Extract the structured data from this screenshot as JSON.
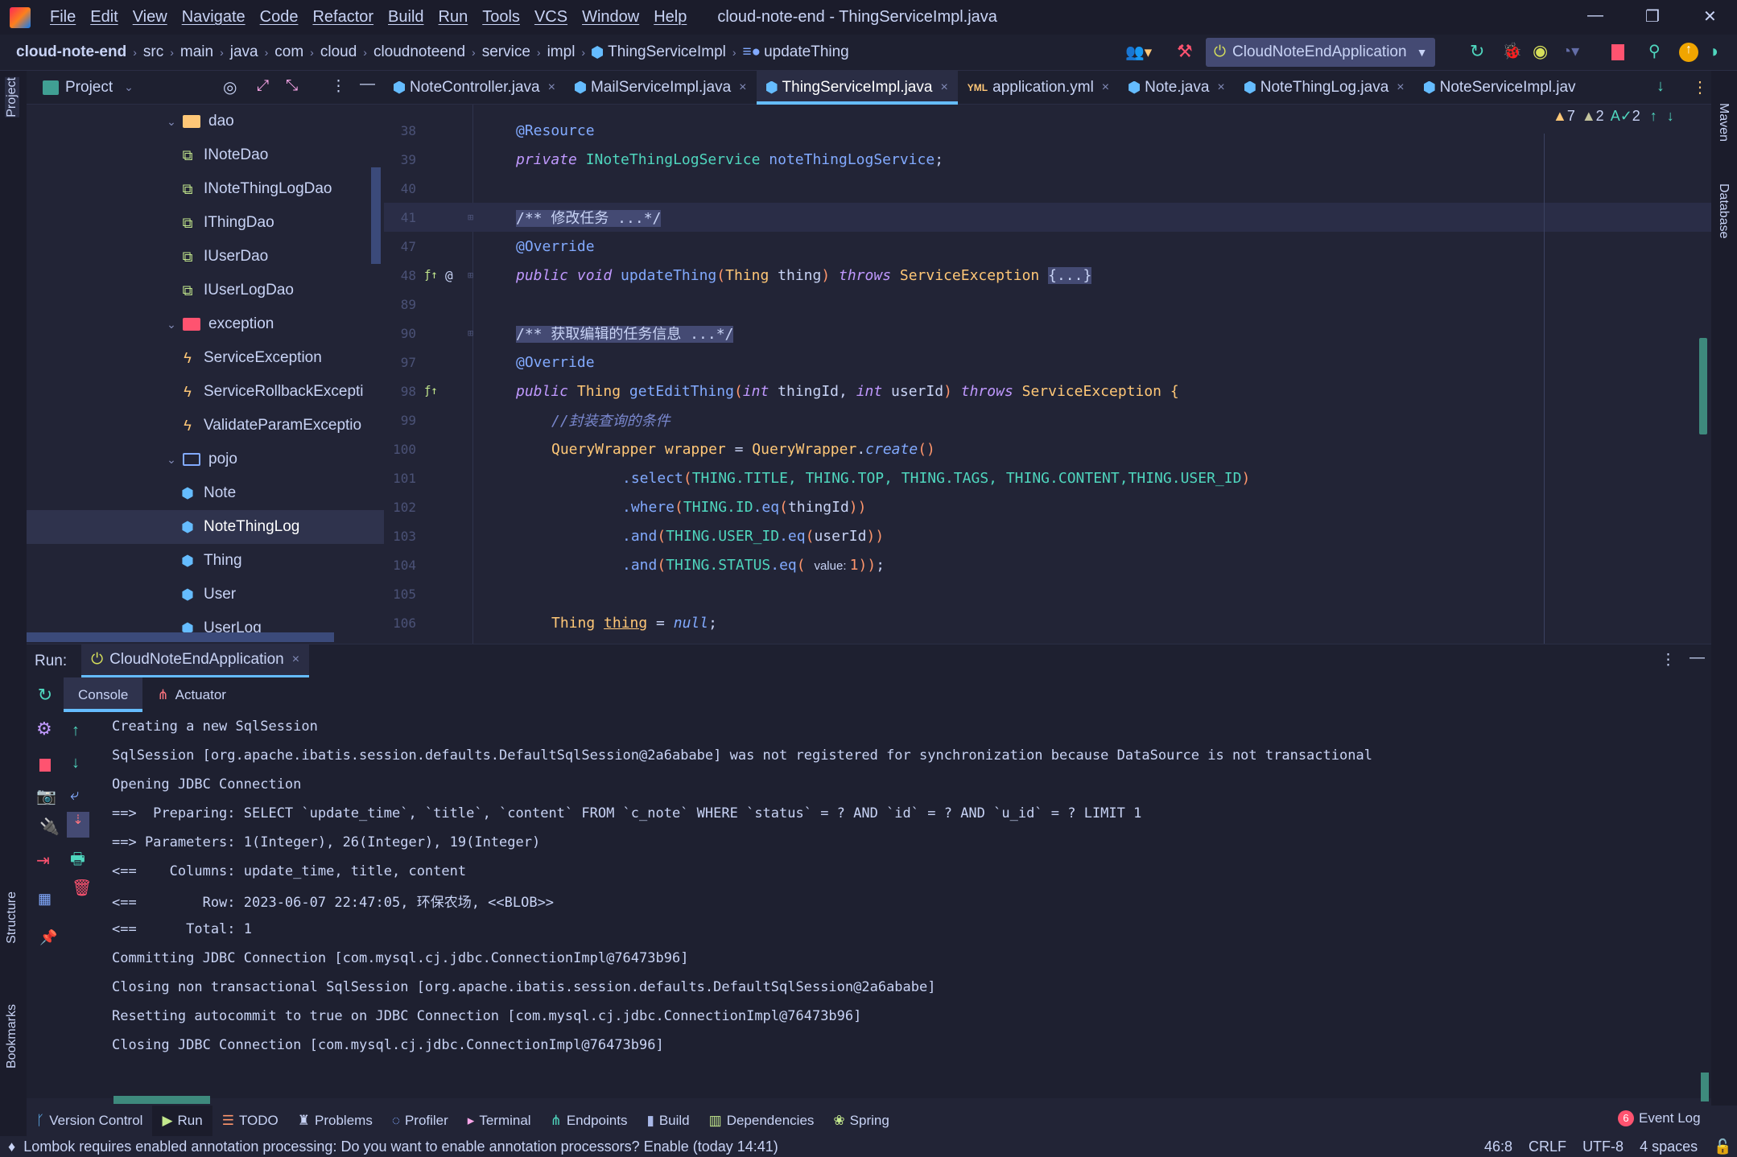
{
  "colors": {
    "accent": "#65bcff",
    "keyword": "#c099ff",
    "type": "#ffc777",
    "function": "#82aaff",
    "constant": "#4fd6be",
    "comment": "#7a88cf",
    "stop": "#ff5370",
    "run": "#c3e88d"
  },
  "titlebar": {
    "menu": [
      "File",
      "Edit",
      "View",
      "Navigate",
      "Code",
      "Refactor",
      "Build",
      "Run",
      "Tools",
      "VCS",
      "Window",
      "Help"
    ],
    "title": "cloud-note-end - ThingServiceImpl.java"
  },
  "breadcrumb": {
    "items": [
      "cloud-note-end",
      "src",
      "main",
      "java",
      "com",
      "cloud",
      "cloudnoteend",
      "service",
      "impl",
      "ThingServiceImpl",
      "updateThing"
    ]
  },
  "toolbar": {
    "run_config": "CloudNoteEndApplication"
  },
  "project": {
    "title": "Project",
    "tree": [
      {
        "label": "dao",
        "type": "folder",
        "expanded": true
      },
      {
        "label": "INoteDao",
        "type": "mapper"
      },
      {
        "label": "INoteThingLogDao",
        "type": "mapper"
      },
      {
        "label": "IThingDao",
        "type": "mapper"
      },
      {
        "label": "IUserDao",
        "type": "mapper"
      },
      {
        "label": "IUserLogDao",
        "type": "mapper"
      },
      {
        "label": "exception",
        "type": "folder-error",
        "expanded": true
      },
      {
        "label": "ServiceException",
        "type": "exception"
      },
      {
        "label": "ServiceRollbackExcepti",
        "type": "exception"
      },
      {
        "label": "ValidateParamExceptio",
        "type": "exception"
      },
      {
        "label": "pojo",
        "type": "folder-plain",
        "expanded": true
      },
      {
        "label": "Note",
        "type": "class"
      },
      {
        "label": "NoteThingLog",
        "type": "class",
        "selected": true
      },
      {
        "label": "Thing",
        "type": "class"
      },
      {
        "label": "User",
        "type": "class"
      },
      {
        "label": "UserLog",
        "type": "class"
      }
    ]
  },
  "tabs": [
    {
      "label": "NoteController.java",
      "icon": "class"
    },
    {
      "label": "MailServiceImpl.java",
      "icon": "class"
    },
    {
      "label": "ThingServiceImpl.java",
      "icon": "class",
      "active": true
    },
    {
      "label": "application.yml",
      "icon": "yaml"
    },
    {
      "label": "Note.java",
      "icon": "class"
    },
    {
      "label": "NoteThingLog.java",
      "icon": "class"
    },
    {
      "label": "NoteServiceImpl.jaᴠ",
      "icon": "class",
      "noclose": true
    }
  ],
  "inspections": {
    "warnings": "7",
    "weak_warnings": "2",
    "typos": "2"
  },
  "right_strip": [
    "Maven",
    "Database"
  ],
  "left_strip": [
    "Project",
    "Structure",
    "Bookmarks"
  ],
  "code": [
    {
      "n": "38",
      "t": [
        [
          "an",
          "@Resource"
        ]
      ]
    },
    {
      "n": "39",
      "t": [
        [
          "kw",
          "private "
        ],
        [
          "cn",
          "INoteThingLogService "
        ],
        [
          "fn",
          "noteThingLogService"
        ],
        [
          "va",
          ";"
        ]
      ]
    },
    {
      "n": "40",
      "t": []
    },
    {
      "n": "41",
      "hl": true,
      "t": [
        [
          "fd",
          "/** 修改任务 ...*/"
        ]
      ]
    },
    {
      "n": "47",
      "t": [
        [
          "an",
          "@Override"
        ]
      ]
    },
    {
      "n": "48",
      "t": [
        [
          "kw",
          "public void "
        ],
        [
          "fn",
          "updateThing"
        ],
        [
          "pn",
          "("
        ],
        [
          "ty",
          "Thing "
        ],
        [
          "va",
          "thing"
        ],
        [
          "pn",
          ")"
        ],
        [
          "kw",
          " throws "
        ],
        [
          "ty",
          "ServiceException "
        ],
        [
          "fd",
          "{...}"
        ]
      ]
    },
    {
      "n": "89",
      "t": []
    },
    {
      "n": "90",
      "t": [
        [
          "fd",
          "/** 获取编辑的任务信息 ...*/"
        ]
      ]
    },
    {
      "n": "97",
      "t": [
        [
          "an",
          "@Override"
        ]
      ]
    },
    {
      "n": "98",
      "t": [
        [
          "kw",
          "public "
        ],
        [
          "ty",
          "Thing "
        ],
        [
          "fn",
          "getEditThing"
        ],
        [
          "pn",
          "("
        ],
        [
          "kw",
          "int "
        ],
        [
          "va",
          "thingId, "
        ],
        [
          "kw",
          "int "
        ],
        [
          "va",
          "userId"
        ],
        [
          "pn",
          ")"
        ],
        [
          "kw",
          " throws "
        ],
        [
          "ty",
          "ServiceException {"
        ]
      ]
    },
    {
      "n": "99",
      "i": 1,
      "t": [
        [
          "co",
          "//封装查询的条件"
        ]
      ]
    },
    {
      "n": "100",
      "i": 1,
      "t": [
        [
          "ty",
          "QueryWrapper "
        ],
        [
          "ty",
          "wrapper"
        ],
        [
          "va",
          " = "
        ],
        [
          "ty",
          "QueryWrapper"
        ],
        [
          "va",
          "."
        ],
        [
          "it",
          "create"
        ],
        [
          "pn",
          "()"
        ]
      ]
    },
    {
      "n": "101",
      "i": 3,
      "t": [
        [
          "fn",
          ".select"
        ],
        [
          "pn",
          "("
        ],
        [
          "cn",
          "THING.TITLE, THING.TOP, THING.TAGS, THING.CONTENT,THING.USER_ID"
        ],
        [
          "pn",
          ")"
        ]
      ]
    },
    {
      "n": "102",
      "i": 3,
      "t": [
        [
          "fn",
          ".where"
        ],
        [
          "pn",
          "("
        ],
        [
          "cn",
          "THING.ID"
        ],
        [
          "fn",
          ".eq"
        ],
        [
          "pn",
          "("
        ],
        [
          "va",
          "thingId"
        ],
        [
          "pn",
          "))"
        ]
      ]
    },
    {
      "n": "103",
      "i": 3,
      "t": [
        [
          "fn",
          ".and"
        ],
        [
          "pn",
          "("
        ],
        [
          "cn",
          "THING.USER_ID"
        ],
        [
          "fn",
          ".eq"
        ],
        [
          "pn",
          "("
        ],
        [
          "va",
          "userId"
        ],
        [
          "pn",
          "))"
        ]
      ]
    },
    {
      "n": "104",
      "i": 3,
      "t": [
        [
          "fn",
          ".and"
        ],
        [
          "pn",
          "("
        ],
        [
          "cn",
          "THING.STATUS"
        ],
        [
          "fn",
          ".eq"
        ],
        [
          "pn",
          "( "
        ],
        [
          "hint",
          "value: "
        ],
        [
          "nu",
          "1"
        ],
        [
          "pn",
          "))"
        ],
        [
          "va",
          ";"
        ]
      ]
    },
    {
      "n": "105",
      "t": []
    },
    {
      "n": "106",
      "i": 1,
      "t": [
        [
          "ty",
          "Thing "
        ],
        [
          "ty ul",
          "thing"
        ],
        [
          "va",
          " = "
        ],
        [
          "it",
          "null"
        ],
        [
          "va",
          ";"
        ]
      ]
    }
  ],
  "run": {
    "label": "Run:",
    "config": "CloudNoteEndApplication",
    "tabs": [
      "Console",
      "Actuator"
    ]
  },
  "console": [
    "Creating a new SqlSession",
    "SqlSession [org.apache.ibatis.session.defaults.DefaultSqlSession@2a6ababe] was not registered for synchronization because DataSource is not transactional",
    "Opening JDBC Connection",
    "==>  Preparing: SELECT `update_time`, `title`, `content` FROM `c_note` WHERE `status` = ? AND `id` = ? AND `u_id` = ? LIMIT 1",
    "==> Parameters: 1(Integer), 26(Integer), 19(Integer)",
    "<==    Columns: update_time, title, content",
    "<==        Row: 2023-06-07 22:47:05, 环保农场, <<BLOB>>",
    "<==      Total: 1",
    "Committing JDBC Connection [com.mysql.cj.jdbc.ConnectionImpl@76473b96]",
    "Closing non transactional SqlSession [org.apache.ibatis.session.defaults.DefaultSqlSession@2a6ababe]",
    "Resetting autocommit to true on JDBC Connection [com.mysql.cj.jdbc.ConnectionImpl@76473b96]",
    "Closing JDBC Connection [com.mysql.cj.jdbc.ConnectionImpl@76473b96]"
  ],
  "bottom_tabs": [
    "Version Control",
    "Run",
    "TODO",
    "Problems",
    "Profiler",
    "Terminal",
    "Endpoints",
    "Build",
    "Dependencies",
    "Spring"
  ],
  "event_log": {
    "label": "Event Log",
    "count": "6"
  },
  "status": {
    "message": "Lombok requires enabled annotation processing: Do you want to enable annotation processors? Enable (today 14:41)",
    "position": "46:8",
    "line_sep": "CRLF",
    "encoding": "UTF-8",
    "indent": "4 spaces"
  }
}
